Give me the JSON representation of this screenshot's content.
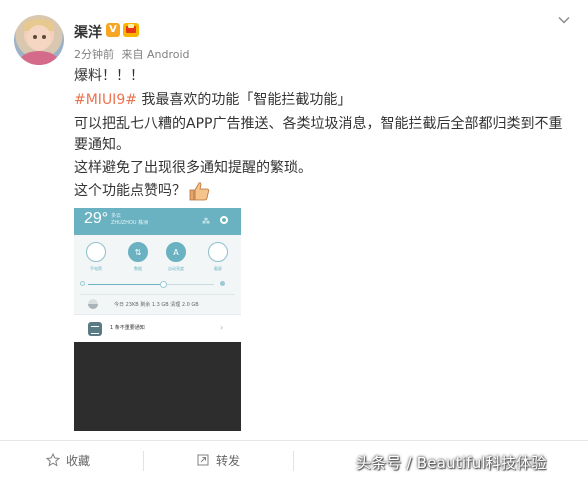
{
  "post": {
    "username": "渠洋",
    "verified_badge": "V",
    "meta": {
      "time": "2分钟前",
      "source": "来自 Android"
    },
    "lines": [
      "爆料！！！",
      "#MIUI9#",
      "我最喜欢的功能「智能拦截功能」",
      "可以把乱七八糟的APP广告推送、各类垃圾消息，智能拦截后全部都归类到不重",
      "要通知。",
      "这样避免了出现很多通知提醒的繁琐。",
      "这个功能点赞吗？"
    ],
    "colors": {
      "topic_tag": "#eb7350",
      "text": "#333333",
      "meta": "#808080",
      "accent": "#6ab2c2"
    }
  },
  "screenshot": {
    "clock": "29°",
    "location": "多云",
    "location_sub": "ZHUZHOU 株洲",
    "toggles": [
      {
        "label": "手电筒",
        "glyph": "",
        "on": false
      },
      {
        "label": "数据",
        "glyph": "⇅",
        "on": true
      },
      {
        "label": "自动亮度",
        "glyph": "A",
        "on": true
      },
      {
        "label": "截屏",
        "glyph": "",
        "on": false
      }
    ],
    "brightness_fraction": 0.6,
    "memory": "今日 23KB   剩余 1.3 GB   清理 2.0 GB",
    "notification": "1 条不重要通知"
  },
  "actions": {
    "favorite_label": "收藏",
    "forward_label": "转发"
  },
  "watermark": "头条号 / Beautiful科技体验"
}
